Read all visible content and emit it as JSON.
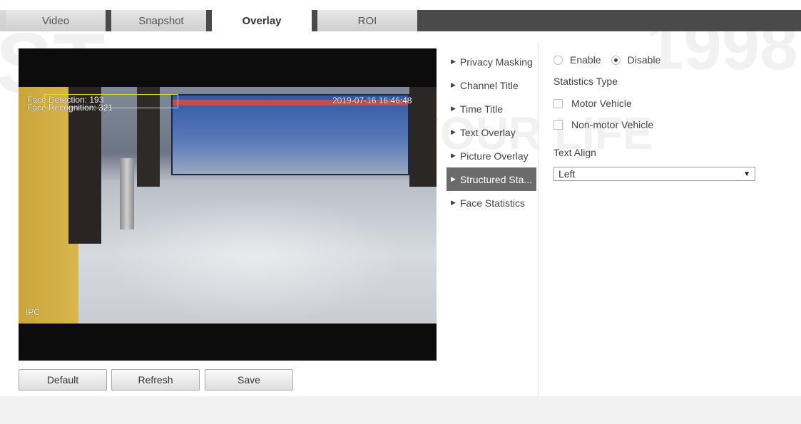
{
  "tabs": [
    {
      "label": "Video",
      "active": false
    },
    {
      "label": "Snapshot",
      "active": false
    },
    {
      "label": "Overlay",
      "active": true
    },
    {
      "label": "ROI",
      "active": false
    }
  ],
  "video": {
    "face_detection": "Face Detection: 193",
    "face_recognition": "Face Recognition: 321",
    "timestamp": "2019-07-16 16:46:48",
    "channel_title": "IPC"
  },
  "buttons": {
    "default_label": "Default",
    "refresh_label": "Refresh",
    "save_label": "Save"
  },
  "menu": [
    {
      "label": "Privacy Masking",
      "active": false
    },
    {
      "label": "Channel Title",
      "active": false
    },
    {
      "label": "Time Title",
      "active": false
    },
    {
      "label": "Text Overlay",
      "active": false
    },
    {
      "label": "Picture Overlay",
      "active": false
    },
    {
      "label": "Structured Sta...",
      "active": true
    },
    {
      "label": "Face Statistics",
      "active": false
    }
  ],
  "panel": {
    "enable_label": "Enable",
    "disable_label": "Disable",
    "enabled": false,
    "statistics_type_label": "Statistics Type",
    "motor_vehicle_label": "Motor Vehicle",
    "motor_vehicle_checked": false,
    "non_motor_vehicle_label": "Non-motor Vehicle",
    "non_motor_vehicle_checked": false,
    "text_align_label": "Text Align",
    "text_align_value": "Left"
  },
  "colors": {
    "active_menu_bg": "#6b6b6b",
    "face_box": "#e8e000",
    "tab_strip_dark": "#4a4a4a"
  }
}
